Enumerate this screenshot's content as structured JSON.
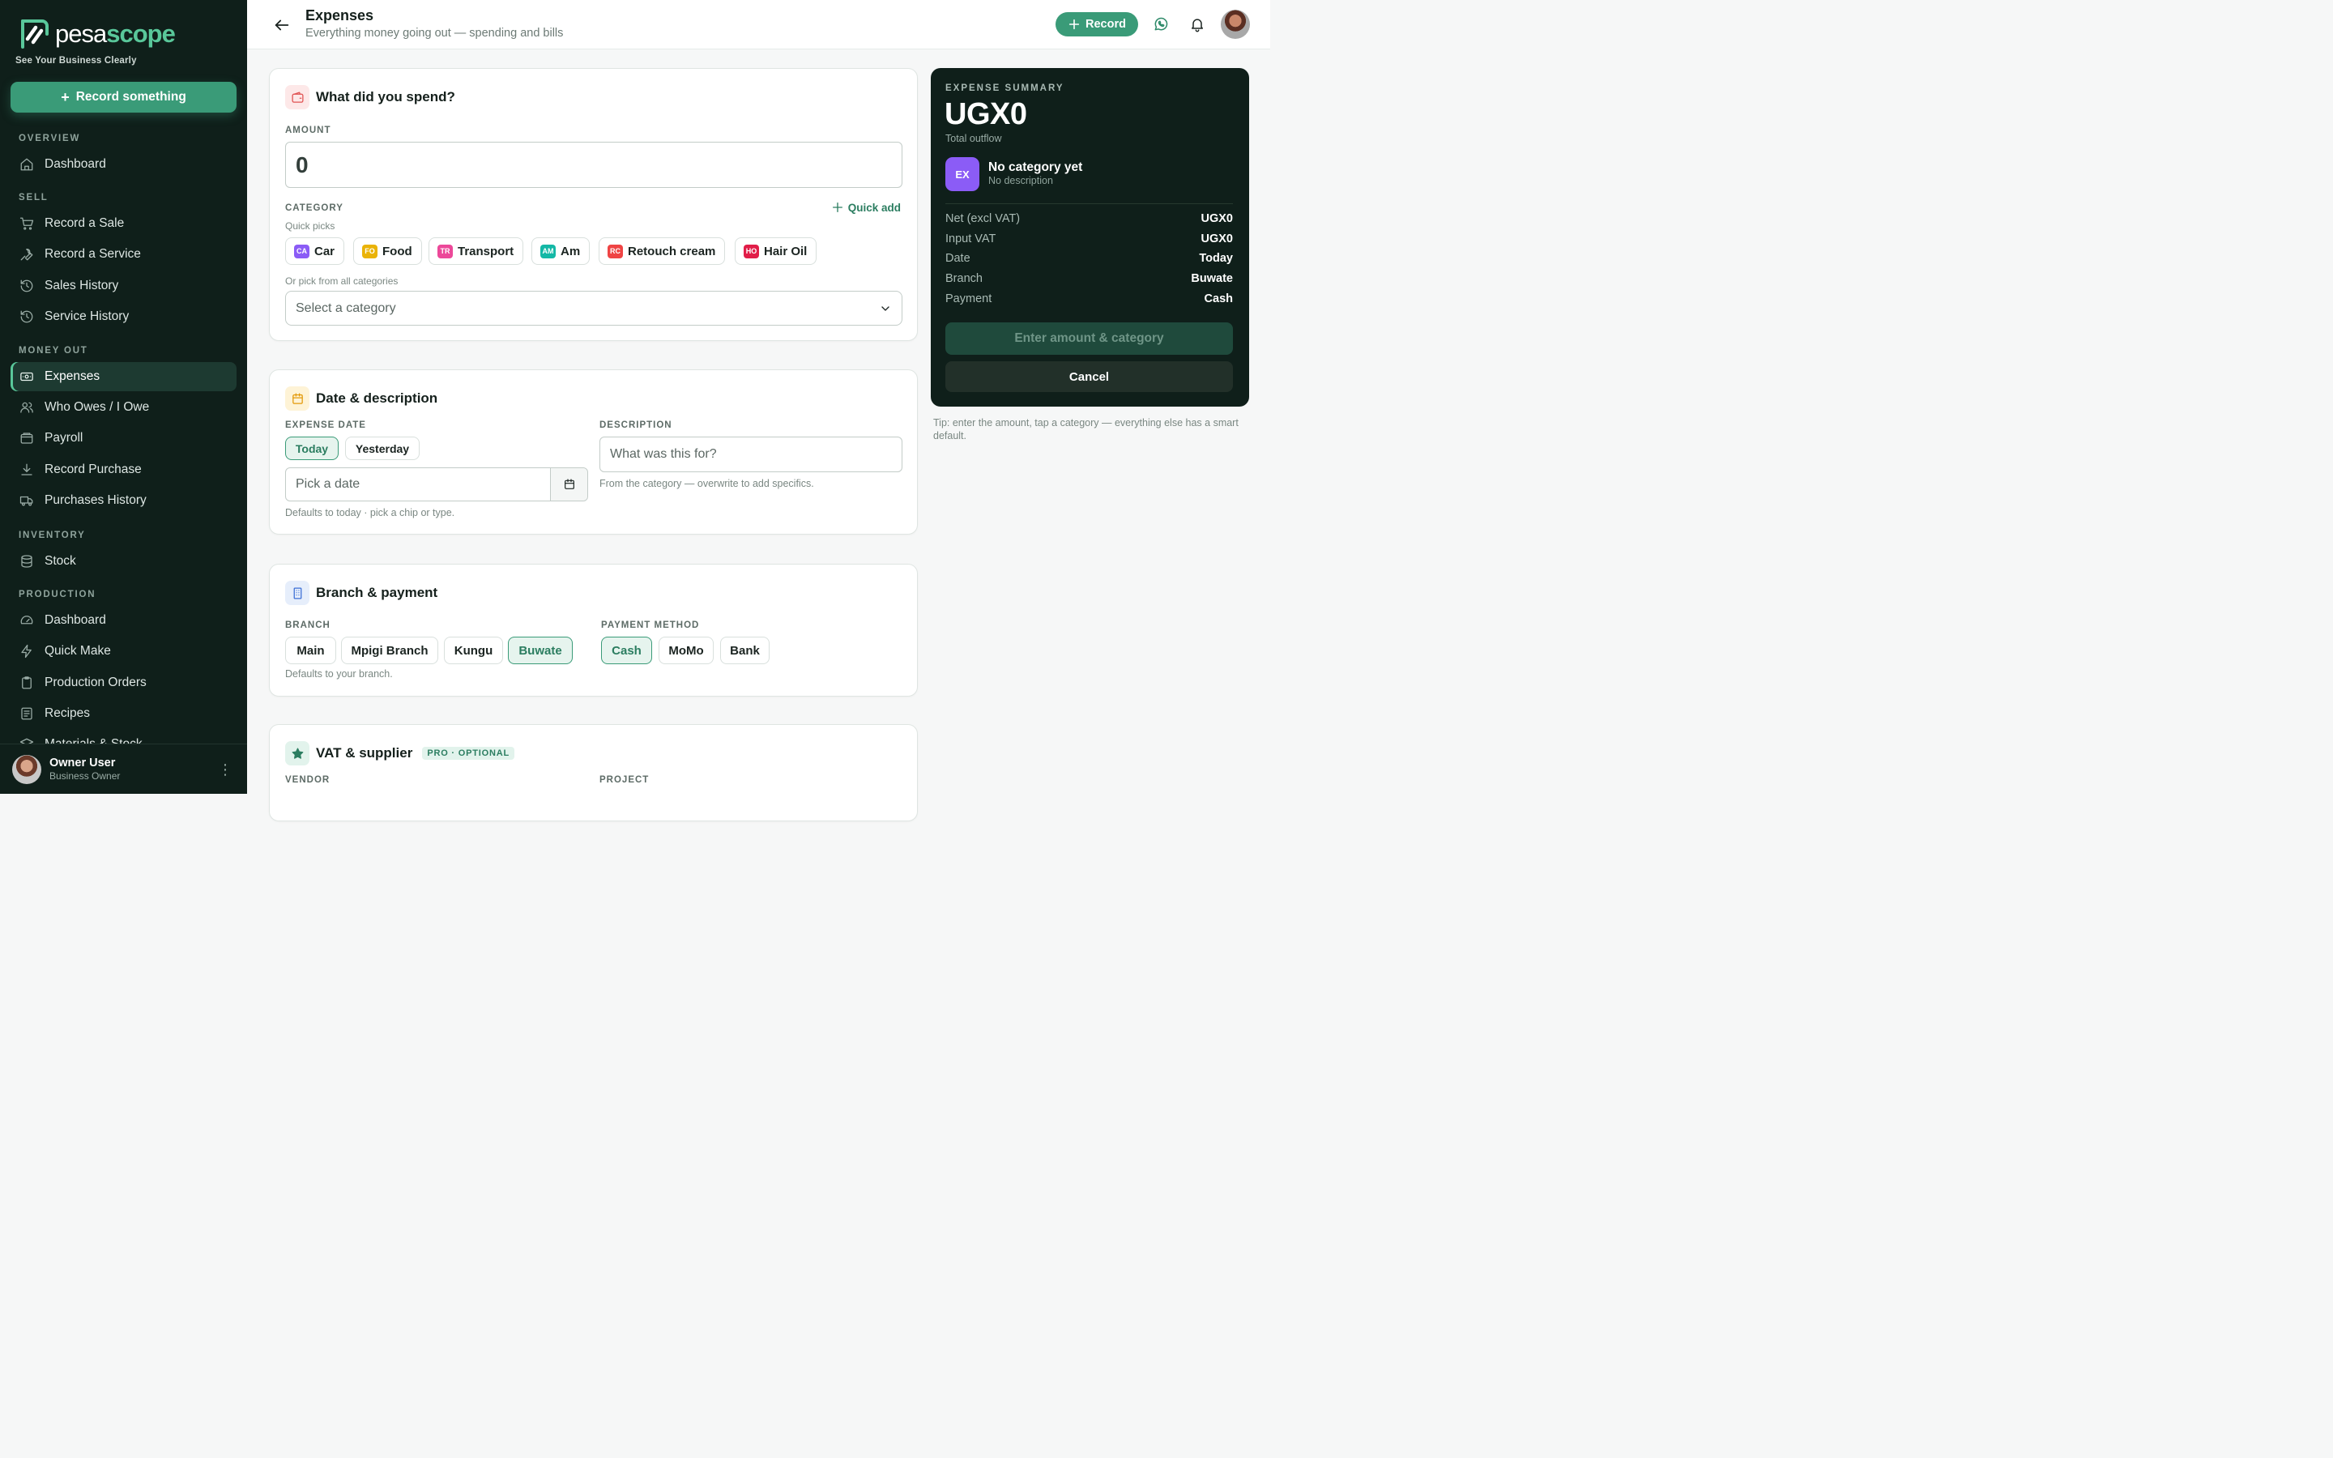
{
  "brand": {
    "name_part1": "pesa",
    "name_part2": "scope",
    "tagline": "See Your Business Clearly",
    "accent_color": "#3a9b78",
    "sidebar_bg": "#0f1f1a"
  },
  "sidebar": {
    "record_button": "Record something",
    "sections": {
      "overview": "OVERVIEW",
      "sell": "SELL",
      "money_out": "MONEY OUT",
      "inventory": "INVENTORY",
      "production": "PRODUCTION"
    },
    "items": {
      "dashboard": "Dashboard",
      "record_sale": "Record a Sale",
      "record_service": "Record a Service",
      "sales_history": "Sales History",
      "service_history": "Service History",
      "expenses": "Expenses",
      "who_owes": "Who Owes / I Owe",
      "payroll": "Payroll",
      "record_purchase": "Record Purchase",
      "purchases_history": "Purchases History",
      "stock": "Stock",
      "prod_dashboard": "Dashboard",
      "quick_make": "Quick Make",
      "production_orders": "Production Orders",
      "recipes": "Recipes",
      "materials_stock": "Materials & Stock"
    },
    "user": {
      "name": "Owner User",
      "role": "Business Owner"
    }
  },
  "header": {
    "title": "Expenses",
    "subtitle": "Everything money going out — spending and bills",
    "record_button": "Record"
  },
  "spend_card": {
    "title": "What did you spend?",
    "amount_label": "AMOUNT",
    "amount_value": "0",
    "category_label": "CATEGORY",
    "quick_add": "Quick add",
    "quick_picks_label": "Quick picks",
    "chips": [
      {
        "code": "CA",
        "label": "Car",
        "color": "#8b5cf6"
      },
      {
        "code": "FO",
        "label": "Food",
        "color": "#eab308"
      },
      {
        "code": "TR",
        "label": "Transport",
        "color": "#ec4899"
      },
      {
        "code": "AM",
        "label": "Am",
        "color": "#14b8a6"
      },
      {
        "code": "RC",
        "label": "Retouch cream",
        "color": "#ef4444"
      },
      {
        "code": "HO",
        "label": "Hair Oil",
        "color": "#e11d48"
      }
    ],
    "all_categories_label": "Or pick from all categories",
    "select_placeholder": "Select a category"
  },
  "date_card": {
    "title": "Date & description",
    "date_label": "EXPENSE DATE",
    "today": "Today",
    "yesterday": "Yesterday",
    "date_placeholder": "Pick a date",
    "date_hint": "Defaults to today · pick a chip or type.",
    "description_label": "DESCRIPTION",
    "description_placeholder": "What was this for?",
    "description_hint": "From the category — overwrite to add specifics."
  },
  "branch_card": {
    "title": "Branch & payment",
    "branch_label": "BRANCH",
    "branches": [
      "Main",
      "Mpigi Branch",
      "Kungu",
      "Buwate"
    ],
    "selected_branch": "Buwate",
    "branch_hint": "Defaults to your branch.",
    "payment_label": "PAYMENT METHOD",
    "methods": [
      "Cash",
      "MoMo",
      "Bank"
    ],
    "selected_method": "Cash"
  },
  "vat_card": {
    "title": "VAT & supplier",
    "badge": "PRO · OPTIONAL",
    "vendor_label": "VENDOR",
    "project_label": "PROJECT"
  },
  "summary": {
    "label": "EXPENSE SUMMARY",
    "amount": "UGX0",
    "amount_sub": "Total outflow",
    "badge": "EX",
    "category": "No category yet",
    "description": "No description",
    "rows": [
      {
        "key": "Net (excl VAT)",
        "value": "UGX0"
      },
      {
        "key": "Input VAT",
        "value": "UGX0"
      },
      {
        "key": "Date",
        "value": "Today"
      },
      {
        "key": "Branch",
        "value": "Buwate"
      },
      {
        "key": "Payment",
        "value": "Cash"
      }
    ],
    "primary_button": "Enter amount & category",
    "cancel_button": "Cancel",
    "tip": "Tip: enter the amount, tap a category — everything else has a smart default."
  }
}
